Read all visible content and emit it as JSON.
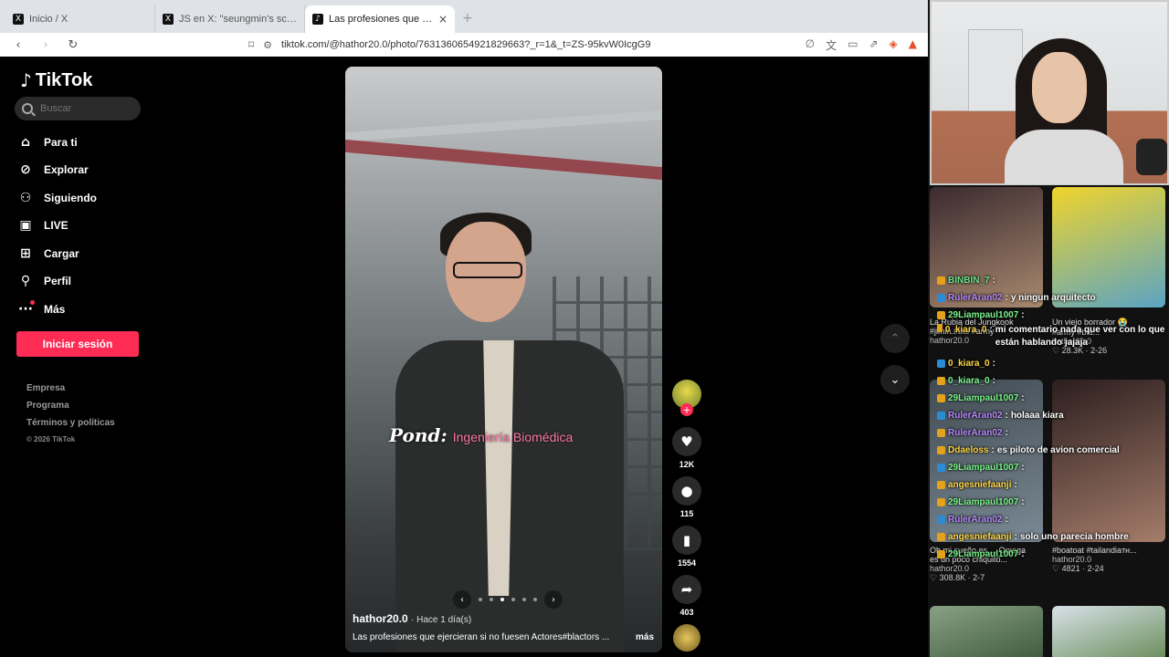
{
  "browser": {
    "tabs": [
      {
        "icon": "X",
        "title": "Inicio / X",
        "active": false
      },
      {
        "icon": "X",
        "title": "JS en X: \"seungmin's scooter now a",
        "active": false
      },
      {
        "icon": "♪",
        "title": "Las profesiones que ejercieran s",
        "active": true
      }
    ],
    "url": "tiktok.com/@hathor20.0/photo/7631360654921829663?_r=1&_t=ZS-95kvW0IcgG9"
  },
  "tiktok": {
    "logo_text": "TikTok",
    "search_placeholder": "Buscar",
    "nav": [
      {
        "icon": "home-icon",
        "glyph": "⌂",
        "label": "Para ti"
      },
      {
        "icon": "compass-icon",
        "glyph": "⊘",
        "label": "Explorar"
      },
      {
        "icon": "following-icon",
        "glyph": "⚇",
        "label": "Siguiendo"
      },
      {
        "icon": "live-icon",
        "glyph": "▣",
        "label": "LIVE"
      },
      {
        "icon": "upload-icon",
        "glyph": "⊞",
        "label": "Cargar"
      },
      {
        "icon": "profile-icon",
        "glyph": "⚲",
        "label": "Perfil"
      },
      {
        "icon": "more-icon",
        "glyph": "···",
        "label": "Más"
      }
    ],
    "login_label": "Iniciar sesión",
    "footer": {
      "company": "Empresa",
      "program": "Programa",
      "terms": "Términos y políticas",
      "copyright": "© 2026 TikTok"
    },
    "video": {
      "caption_label": "Pond:",
      "caption_value": "Ingeniería Biomédica",
      "author": "hathor20.0",
      "ago": "· Hace 1 día(s)",
      "description": "Las profesiones que ejercieran si no fuesen Actores#blactors ...",
      "more": "más"
    },
    "actions": {
      "likes": "12K",
      "comments": "115",
      "saves": "1554",
      "shares": "403"
    }
  },
  "stream": {
    "thumbs": [
      {
        "name": "La Rubia del Jungkook",
        "tags": "#jimin #bts #army",
        "author": "hathor20.0",
        "stats": ""
      },
      {
        "name": "Un viejo borrador 😭",
        "tags": "#army #bts...",
        "author": "hathor20.0",
        "stats": "♡ 28.3K · 2-26"
      },
      {
        "name": "Oh mi sueño es ... Omega",
        "tags": "es un poco chiquito...",
        "author": "hathor20.0",
        "stats": "♡ 308.8K · 2-7"
      },
      {
        "name": "",
        "tags": "#boatoat #tailandiaтн...",
        "author": "hathor20.0",
        "stats": "♡ 4821 · 2-24"
      }
    ],
    "chat": [
      {
        "user": "BINBIN_7",
        "color": "#6fe38a",
        "text": ""
      },
      {
        "user": "RulerAran02",
        "color": "#b88bff",
        "text": "y ningun arquitecto"
      },
      {
        "user": "29Liampaul1007",
        "color": "#7cf58d",
        "text": ""
      },
      {
        "user": "0_kiara_0",
        "color": "#ffd84a",
        "text": "mi comentario nada que ver con lo que están hablando jajaja"
      },
      {
        "user": "0_kiara_0",
        "color": "#ffd84a",
        "text": ""
      },
      {
        "user": "0_kiara_0",
        "color": "#7cf58d",
        "text": ""
      },
      {
        "user": "29Liampaul1007",
        "color": "#7cf58d",
        "text": ""
      },
      {
        "user": "RulerAran02",
        "color": "#b88bff",
        "text": "holaaa kiara"
      },
      {
        "user": "RulerAran02",
        "color": "#b88bff",
        "text": ""
      },
      {
        "user": "Ddaeloss",
        "color": "#ffd84a",
        "text": "es piloto de avion comercial"
      },
      {
        "user": "29Liampaul1007",
        "color": "#7cf58d",
        "text": ""
      },
      {
        "user": "angesniefaanji",
        "color": "#ffd84a",
        "text": ""
      },
      {
        "user": "29Liampaul1007",
        "color": "#7cf58d",
        "text": ""
      },
      {
        "user": "RulerAran02",
        "color": "#b88bff",
        "text": ""
      },
      {
        "user": "angesniefaanji",
        "color": "#ffd84a",
        "text": "solo uno parecia hombre"
      },
      {
        "user": "29Liampaul1007",
        "color": "#7cf58d",
        "text": ""
      }
    ]
  }
}
